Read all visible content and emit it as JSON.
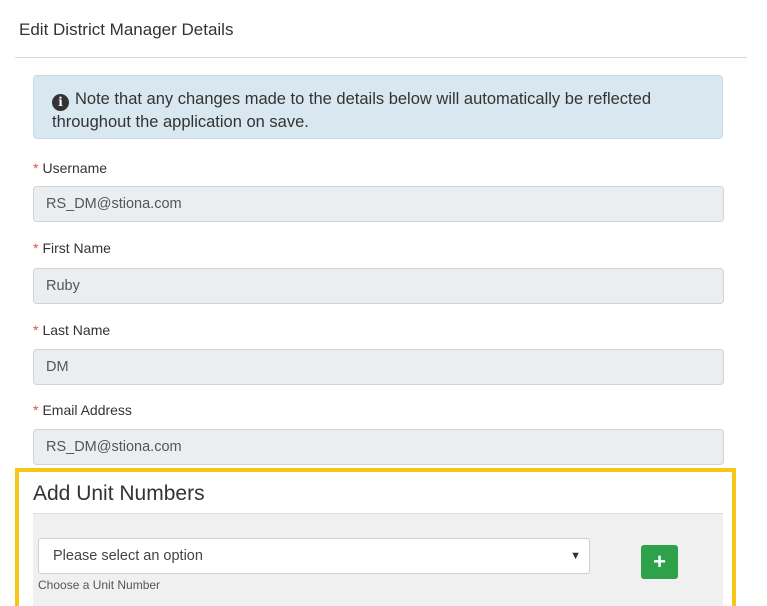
{
  "header": {
    "title": "Edit District Manager Details"
  },
  "alert": {
    "icon": "info-circle-icon",
    "text": "Note that any changes made to the details below will automatically be reflected throughout the application on save."
  },
  "form": {
    "required_marker": "*",
    "username": {
      "label": "Username",
      "value": "RS_DM@stiona.com"
    },
    "first_name": {
      "label": "First Name",
      "value": "Ruby"
    },
    "last_name": {
      "label": "Last Name",
      "value": "DM"
    },
    "email": {
      "label": "Email Address",
      "value": "RS_DM@stiona.com"
    }
  },
  "unit_numbers": {
    "title": "Add Unit Numbers",
    "select_placeholder": "Please select an option",
    "select_help": "Choose a Unit Number",
    "add_button_icon": "plus-icon",
    "add_button_glyph": "+"
  },
  "colors": {
    "highlight": "#f5c518",
    "add_button": "#2ea14b",
    "required": "#d9534f",
    "alert_bg": "#d9e8f0"
  }
}
